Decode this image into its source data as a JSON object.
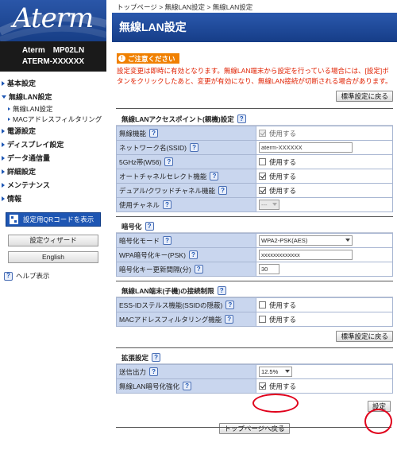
{
  "sidebar": {
    "logo_text": "Aterm",
    "model_line1": "Aterm　MP02LN",
    "model_line2": "ATERM-XXXXXX",
    "menu": [
      {
        "label": "基本設定",
        "expanded": false
      },
      {
        "label": "無線LAN設定",
        "expanded": true,
        "children": [
          "無線LAN設定",
          "MACアドレスフィルタリング"
        ]
      },
      {
        "label": "電源設定",
        "expanded": false
      },
      {
        "label": "ディスプレイ設定",
        "expanded": false
      },
      {
        "label": "データ通信量",
        "expanded": false
      },
      {
        "label": "詳細設定",
        "expanded": false
      },
      {
        "label": "メンテナンス",
        "expanded": false
      },
      {
        "label": "情報",
        "expanded": false
      }
    ],
    "qr_button": "設定用QRコードを表示",
    "wizard_button": "設定ウィザード",
    "english_button": "English",
    "help_link": "ヘルプ表示"
  },
  "main": {
    "breadcrumb": "トップページ > 無線LAN設定 > 無線LAN設定",
    "title": "無線LAN設定",
    "caution_label": "ご注意ください",
    "notice": "設定変更は即時に有効となります。無線LAN端末から設定を行っている場合には、[設定]ボタンをクリックしたあと、変更が有効になり、無線LAN接続が切断される場合があります。",
    "reset_default_button": "標準設定に戻る",
    "sections": {
      "ap": {
        "title": "無線LANアクセスポイント(親機)設定",
        "rows": {
          "wireless": {
            "label": "無線機能",
            "value": "使用する",
            "checked": true
          },
          "ssid": {
            "label": "ネットワーク名(SSID)",
            "value": "aterm-XXXXXX"
          },
          "band5g": {
            "label": "5GHz帯(W56)",
            "value": "使用する",
            "checked": false
          },
          "auto_channel": {
            "label": "オートチャネルセレクト機能",
            "value": "使用する",
            "checked": true
          },
          "dual_channel": {
            "label": "デュアル/クワッドチャネル機能",
            "value": "使用する",
            "checked": true
          },
          "channel": {
            "label": "使用チャネル",
            "value": "---"
          }
        }
      },
      "encryption": {
        "title": "暗号化",
        "rows": {
          "mode": {
            "label": "暗号化モード",
            "value": "WPA2-PSK(AES)"
          },
          "key": {
            "label": "WPA暗号化キー(PSK)",
            "value": "xxxxxxxxxxxxx"
          },
          "interval": {
            "label": "暗号化キー更新間隔(分)",
            "value": "30"
          }
        }
      },
      "restriction": {
        "title": "無線LAN端末(子機)の接続制限",
        "rows": {
          "stealth": {
            "label": "ESS-IDステルス機能(SSIDの隠蔽)",
            "value": "使用する",
            "checked": false
          },
          "mac_filter": {
            "label": "MACアドレスフィルタリング機能",
            "value": "使用する",
            "checked": false
          }
        }
      },
      "extended": {
        "title": "拡張設定",
        "rows": {
          "tx_power": {
            "label": "送信出力",
            "value": "12.5%"
          },
          "enhance": {
            "label": "無線LAN暗号化強化",
            "value": "使用する",
            "checked": true
          }
        }
      }
    },
    "reset_default_button_2": "標準設定に戻る",
    "apply_button": "設定",
    "back_top_button": "トップページへ戻る"
  },
  "colors": {
    "brand_blue": "#1e56b3",
    "label_bg": "#c9d6ee",
    "warning_red": "#e02000",
    "caution_orange": "#f08000",
    "highlight_circle": "#e0001b"
  }
}
